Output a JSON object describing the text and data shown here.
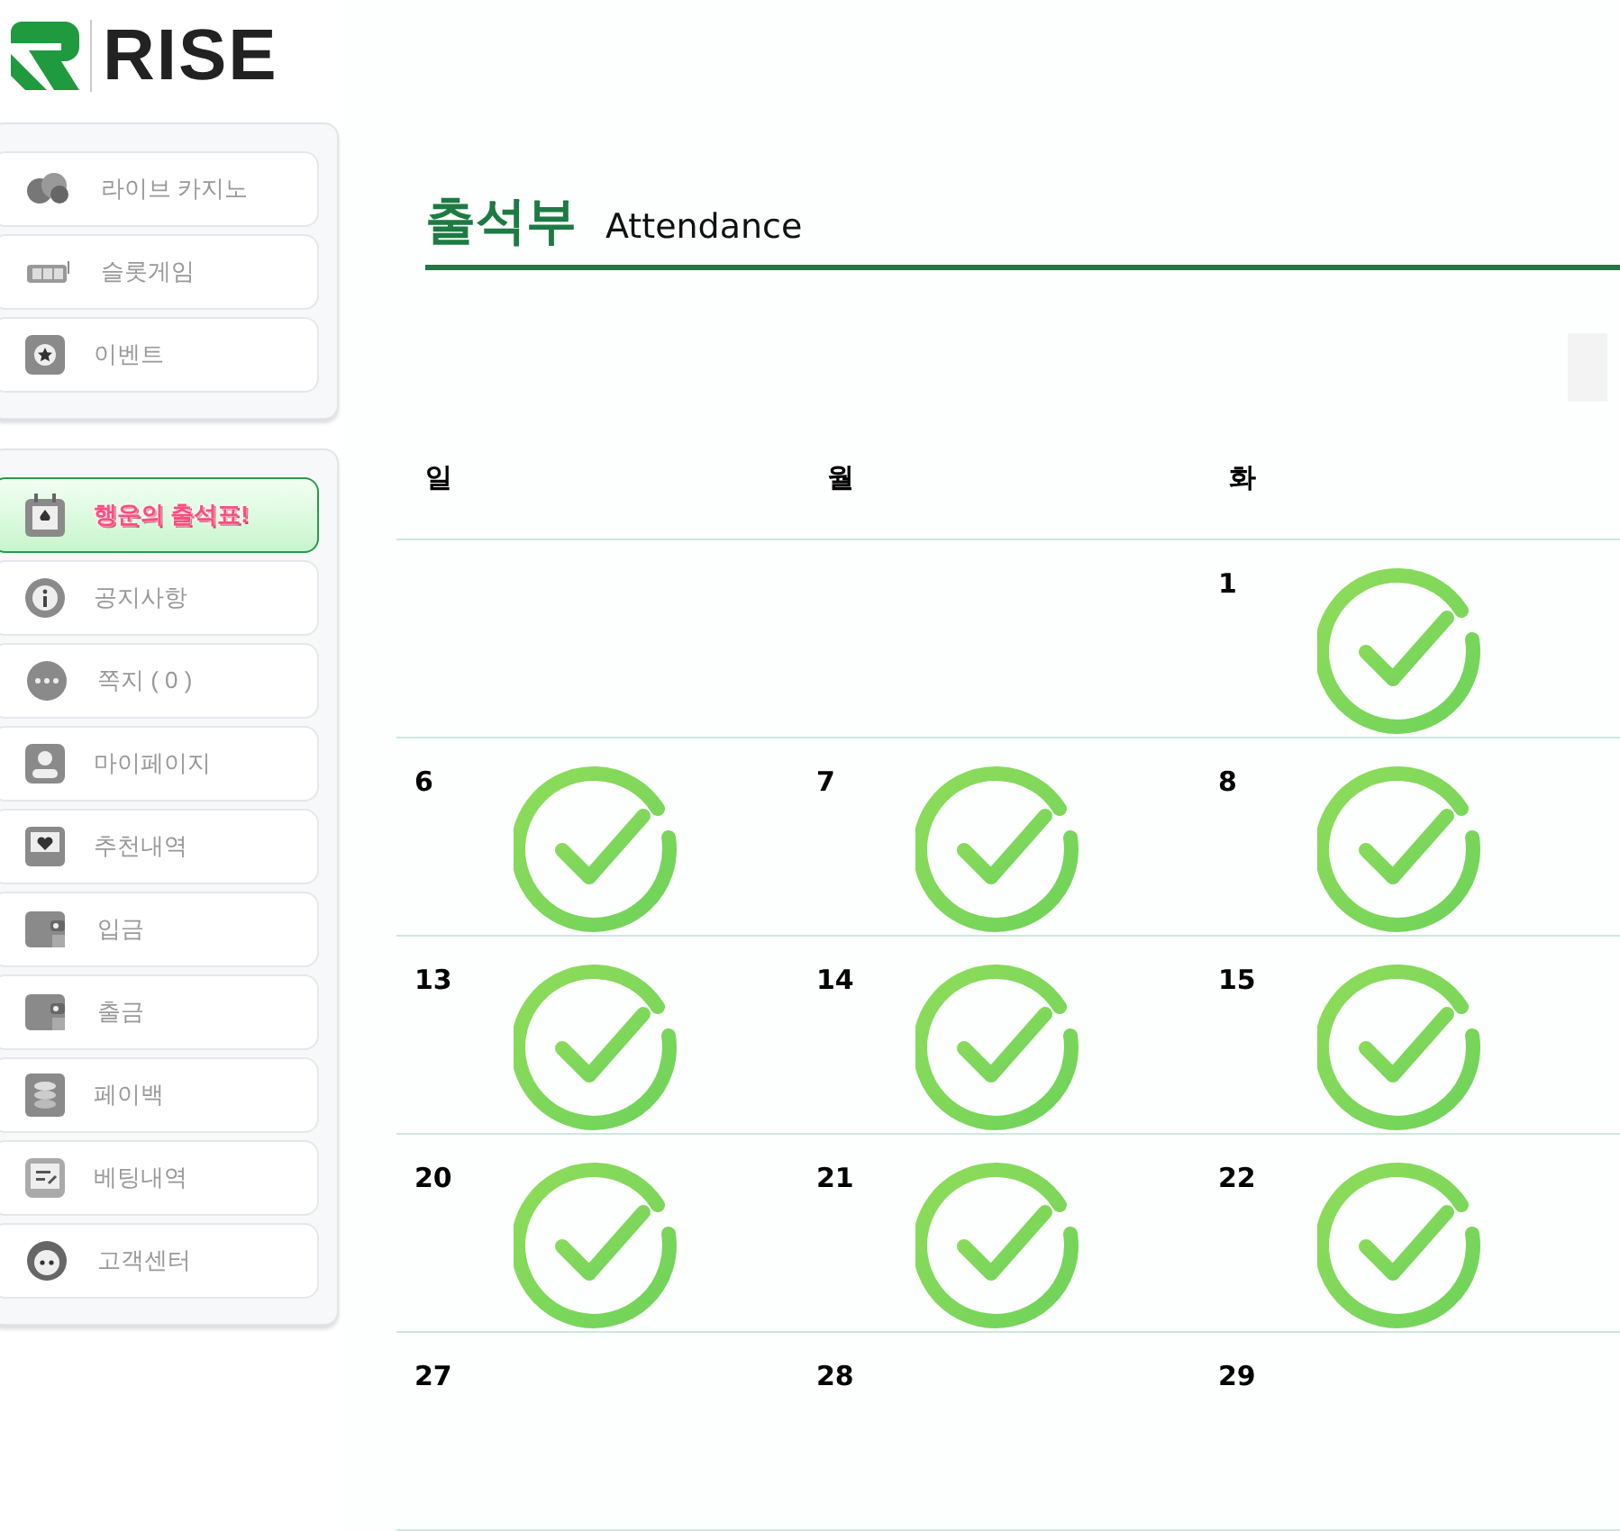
{
  "logo": {
    "text": "RISE"
  },
  "sidebar": {
    "groups": [
      {
        "items": [
          {
            "label": "라이브 카지노",
            "kind": "chips",
            "selected": false
          },
          {
            "label": "슬롯게임",
            "kind": "slot",
            "selected": false
          },
          {
            "label": "이벤트",
            "kind": "star",
            "selected": false
          }
        ]
      },
      {
        "items": [
          {
            "label": "행운의 출석표!",
            "kind": "calendar",
            "selected": true
          },
          {
            "label": "공지사항",
            "kind": "info",
            "selected": false
          },
          {
            "label": "쪽지 ( 0 )",
            "kind": "chat",
            "selected": false
          },
          {
            "label": "마이페이지",
            "kind": "user",
            "selected": false
          },
          {
            "label": "추천내역",
            "kind": "heart",
            "selected": false
          },
          {
            "label": "입금",
            "kind": "wallet",
            "selected": false
          },
          {
            "label": "출금",
            "kind": "wallet",
            "selected": false
          },
          {
            "label": "페이백",
            "kind": "coins",
            "selected": false
          },
          {
            "label": "베팅내역",
            "kind": "note",
            "selected": false
          },
          {
            "label": "고객센터",
            "kind": "support",
            "selected": false
          }
        ]
      }
    ]
  },
  "page": {
    "title": "출석부",
    "subtitle": "Attendance"
  },
  "calendar": {
    "weekdays": [
      "일",
      "월",
      "화"
    ],
    "weeks": [
      [
        {
          "kind": "blank"
        },
        {
          "kind": "blank"
        },
        {
          "kind": "day",
          "day": "1",
          "checked": true
        }
      ],
      [
        {
          "kind": "day",
          "day": "6",
          "checked": true
        },
        {
          "kind": "day",
          "day": "7",
          "checked": true
        },
        {
          "kind": "day",
          "day": "8",
          "checked": true
        }
      ],
      [
        {
          "kind": "day",
          "day": "13",
          "checked": true
        },
        {
          "kind": "day",
          "day": "14",
          "checked": true
        },
        {
          "kind": "day",
          "day": "15",
          "checked": true
        }
      ],
      [
        {
          "kind": "day",
          "day": "20",
          "checked": true
        },
        {
          "kind": "day",
          "day": "21",
          "checked": true
        },
        {
          "kind": "day",
          "day": "22",
          "checked": true
        }
      ],
      [
        {
          "kind": "day",
          "day": "27",
          "checked": false
        },
        {
          "kind": "day",
          "day": "28",
          "checked": false
        },
        {
          "kind": "day",
          "day": "29",
          "checked": false
        }
      ]
    ]
  }
}
